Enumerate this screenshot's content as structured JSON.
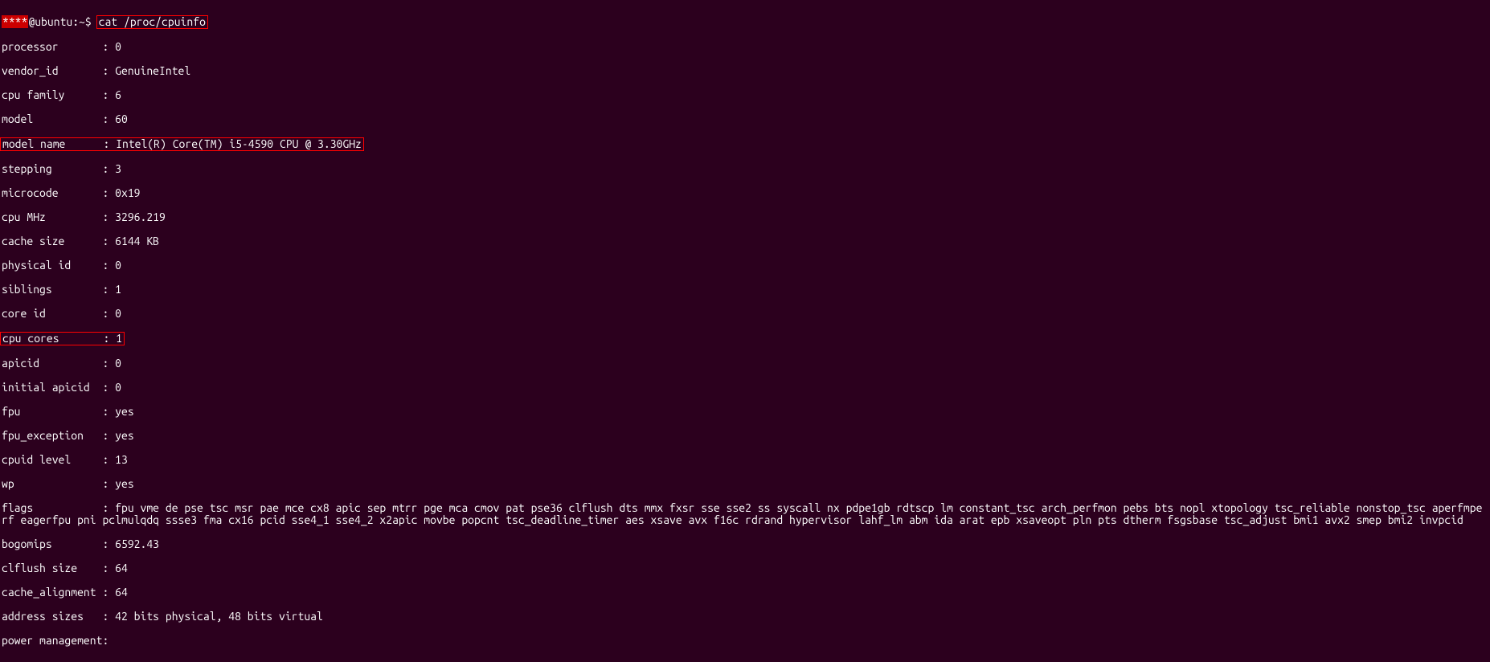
{
  "prompt": {
    "user_masked": "****",
    "host_part": "@ubuntu:~$ ",
    "command": "cat /proc/cpuinfo"
  },
  "cpuinfo": {
    "processor": {
      "k": "processor",
      "v": "0"
    },
    "vendor_id": {
      "k": "vendor_id",
      "v": "GenuineIntel"
    },
    "cpu_family": {
      "k": "cpu family",
      "v": "6"
    },
    "model": {
      "k": "model",
      "v": "60"
    },
    "model_name": {
      "k": "model name",
      "v": "Intel(R) Core(TM) i5-4590 CPU @ 3.30GHz"
    },
    "stepping": {
      "k": "stepping",
      "v": "3"
    },
    "microcode": {
      "k": "microcode",
      "v": "0x19"
    },
    "cpu_mhz": {
      "k": "cpu MHz",
      "v": "3296.219"
    },
    "cache_size": {
      "k": "cache size",
      "v": "6144 KB"
    },
    "physical_id": {
      "k": "physical id",
      "v": "0"
    },
    "siblings": {
      "k": "siblings",
      "v": "1"
    },
    "core_id": {
      "k": "core id",
      "v": "0"
    },
    "cpu_cores": {
      "k": "cpu cores",
      "v": "1"
    },
    "apicid": {
      "k": "apicid",
      "v": "0"
    },
    "initial_apicid": {
      "k": "initial apicid",
      "v": "0"
    },
    "fpu": {
      "k": "fpu",
      "v": "yes"
    },
    "fpu_exception": {
      "k": "fpu_exception",
      "v": "yes"
    },
    "cpuid_level": {
      "k": "cpuid level",
      "v": "13"
    },
    "wp": {
      "k": "wp",
      "v": "yes"
    },
    "flags": {
      "k": "flags",
      "v": "fpu vme de pse tsc msr pae mce cx8 apic sep mtrr pge mca cmov pat pse36 clflush dts mmx fxsr sse sse2 ss syscall nx pdpe1gb rdtscp lm constant_tsc arch_perfmon pebs bts nopl xtopology tsc_reliable nonstop_tsc aperfmperf eagerfpu pni pclmulqdq ssse3 fma cx16 pcid sse4_1 sse4_2 x2apic movbe popcnt tsc_deadline_timer aes xsave avx f16c rdrand hypervisor lahf_lm abm ida arat epb xsaveopt pln pts dtherm fsgsbase tsc_adjust bmi1 avx2 smep bmi2 invpcid"
    },
    "bogomips": {
      "k": "bogomips",
      "v": "6592.43"
    },
    "clflush_size": {
      "k": "clflush size",
      "v": "64"
    },
    "cache_alignment": {
      "k": "cache_alignment",
      "v": "64"
    },
    "address_sizes": {
      "k": "address sizes",
      "v": "42 bits physical, 48 bits virtual"
    },
    "power_management": {
      "k": "power management:",
      "v": ""
    }
  }
}
